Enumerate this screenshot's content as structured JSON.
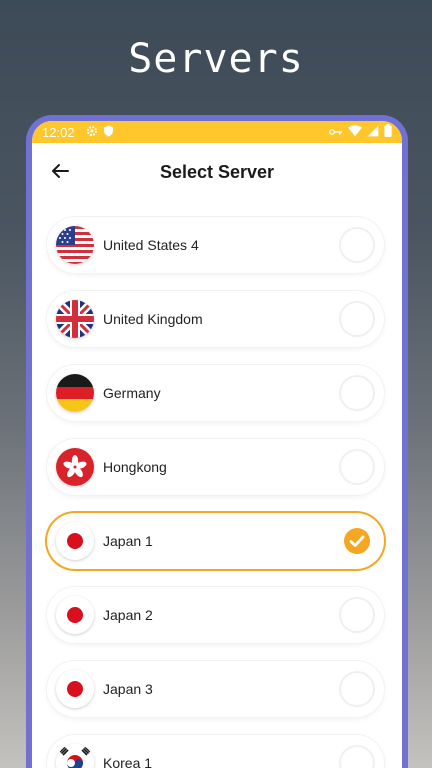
{
  "promo": {
    "title": "Servers"
  },
  "status_bar": {
    "time": "12:02"
  },
  "header": {
    "title": "Select Server"
  },
  "servers": [
    {
      "name": "United States 4",
      "flag": "us-flag-icon",
      "selected": false
    },
    {
      "name": "United Kingdom",
      "flag": "uk-flag-icon",
      "selected": false
    },
    {
      "name": "Germany",
      "flag": "germany-flag-icon",
      "selected": false
    },
    {
      "name": "Hongkong",
      "flag": "hongkong-flag-icon",
      "selected": false
    },
    {
      "name": "Japan 1",
      "flag": "japan-flag-icon",
      "selected": true
    },
    {
      "name": "Japan 2",
      "flag": "japan-flag-icon",
      "selected": false
    },
    {
      "name": "Japan 3",
      "flag": "japan-flag-icon",
      "selected": false
    },
    {
      "name": "Korea 1",
      "flag": "korea-flag-icon",
      "selected": false
    }
  ],
  "colors": {
    "accent": "#ffc72c",
    "selected_border": "#f5a623",
    "phone_frame": "#7171d4"
  }
}
